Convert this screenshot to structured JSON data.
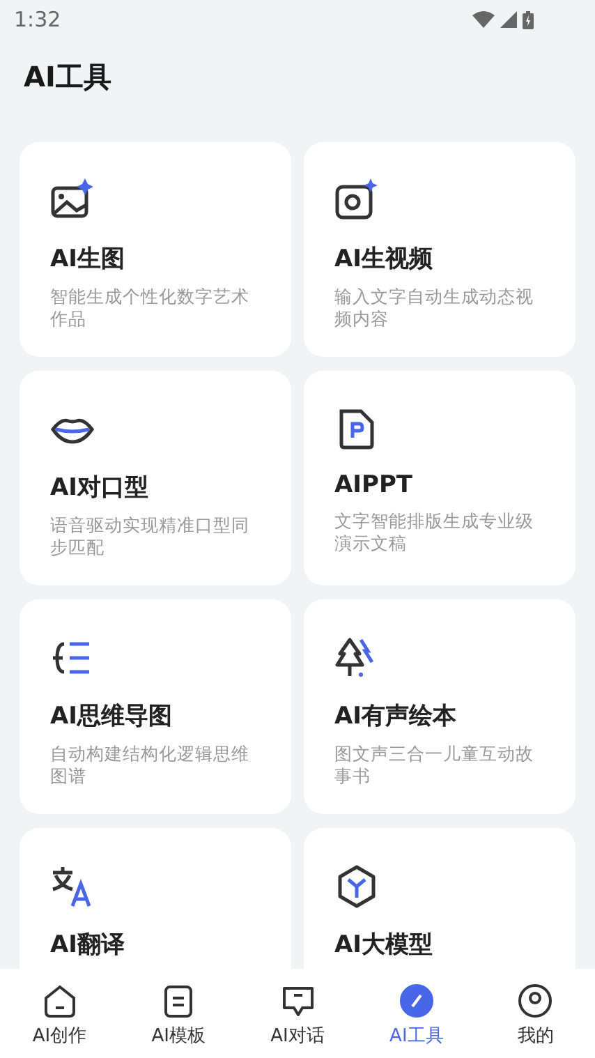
{
  "status_bar": {
    "time": "1:32"
  },
  "title": "AI工具",
  "tools": [
    {
      "kind": "image",
      "name": "AI生图",
      "description": "智能生成个性化数字艺术作品"
    },
    {
      "kind": "video",
      "name": "AI生视频",
      "description": "输入文字自动生成动态视频内容"
    },
    {
      "kind": "lips",
      "name": "AI对口型",
      "description": "语音驱动实现精准口型同步匹配"
    },
    {
      "kind": "ppt",
      "name": "AIPPT",
      "description": "文字智能排版生成专业级演示文稿"
    },
    {
      "kind": "mindmap",
      "name": "AI思维导图",
      "description": "自动构建结构化逻辑思维图谱"
    },
    {
      "kind": "tree",
      "name": "AI有声绘本",
      "description": "图文声三合一儿童互动故事书"
    },
    {
      "kind": "translate",
      "name": "AI翻译"
    },
    {
      "kind": "cube",
      "name": "AI大模型"
    }
  ],
  "tab_bar": [
    {
      "kind": "home",
      "label": "AI创作",
      "selected": false
    },
    {
      "kind": "template",
      "label": "AI模板",
      "selected": false
    },
    {
      "kind": "chat",
      "label": "AI对话",
      "selected": false
    },
    {
      "kind": "tools",
      "label": "AI工具",
      "selected": true
    },
    {
      "kind": "profile",
      "label": "我的",
      "selected": false
    }
  ]
}
